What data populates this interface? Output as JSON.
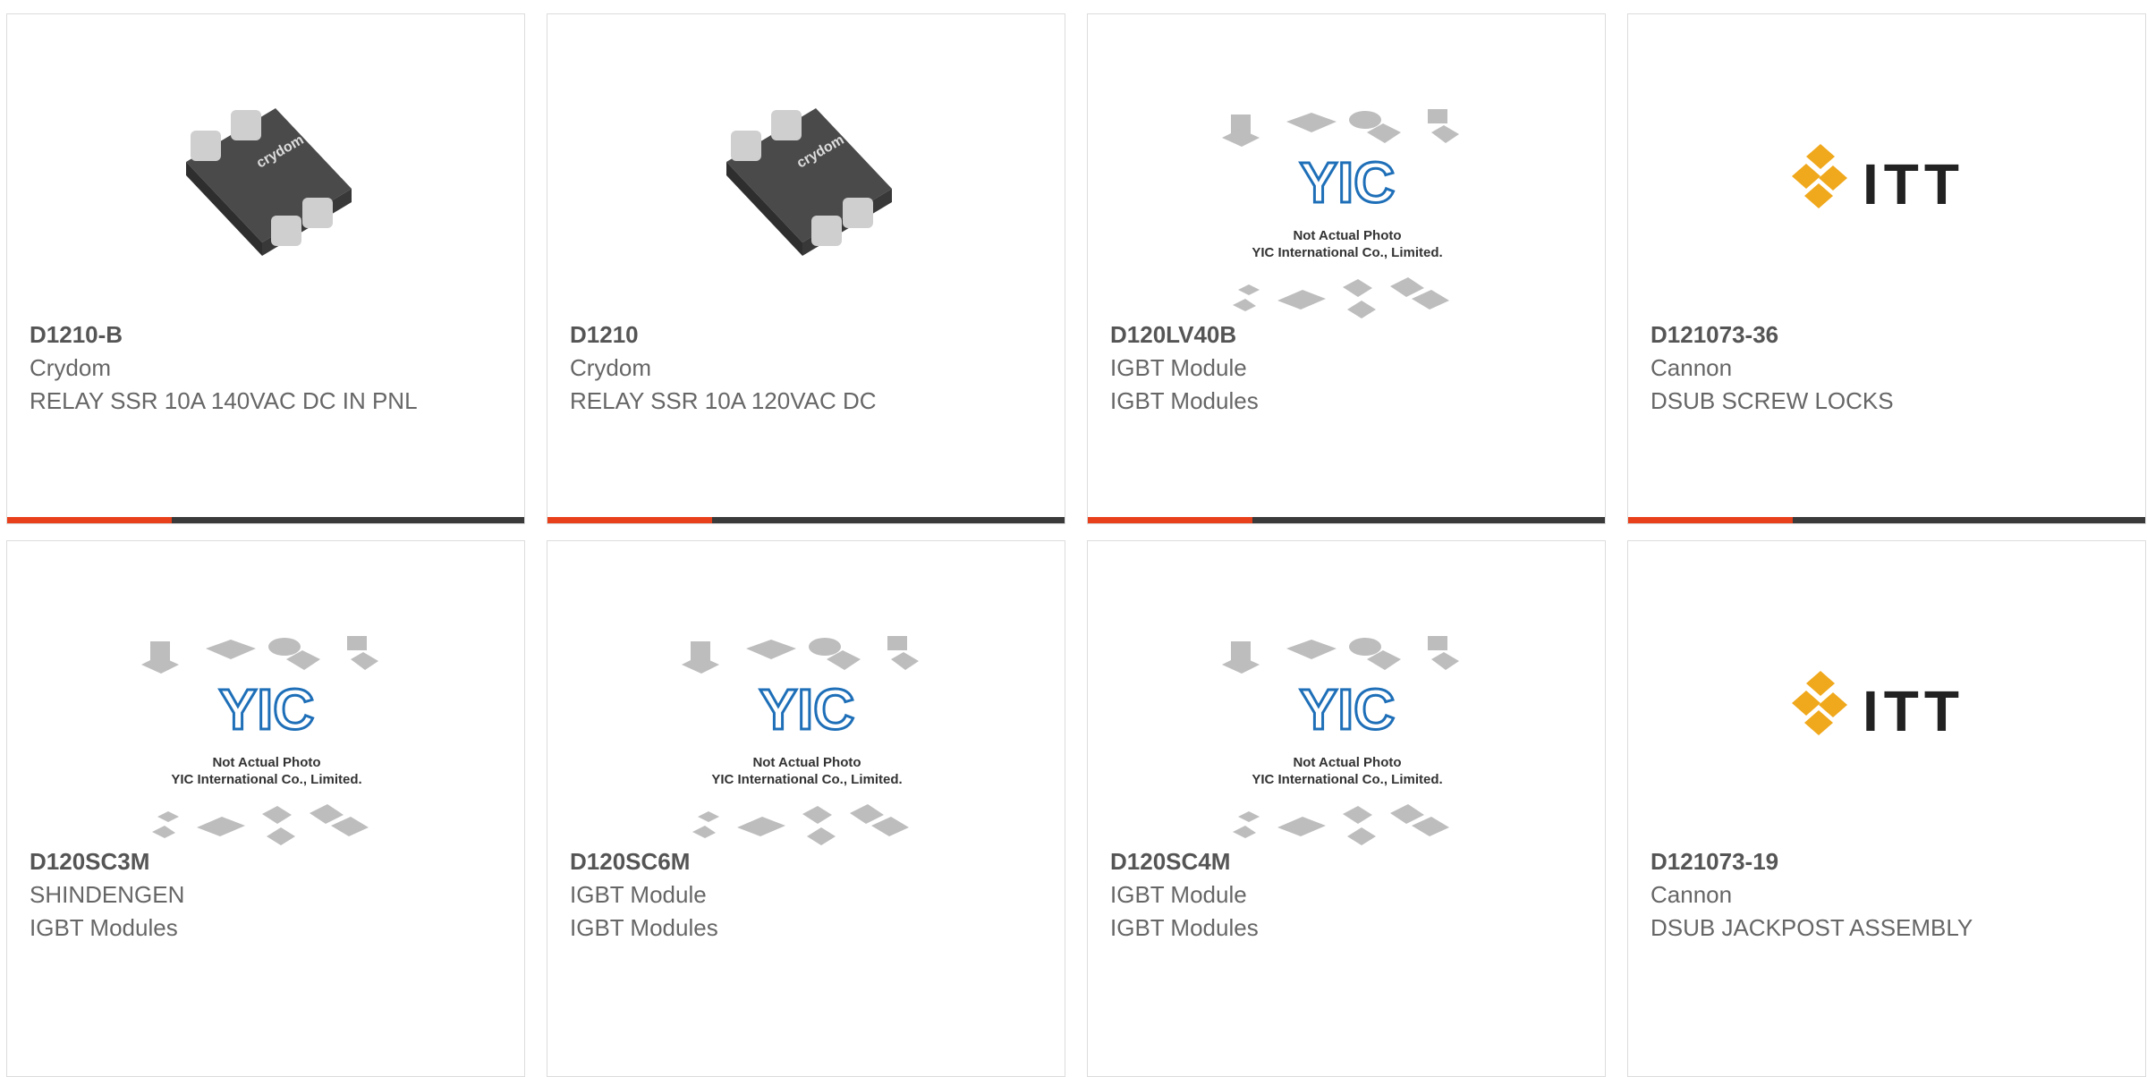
{
  "colors": {
    "accent": "#e8401a",
    "dark_bar": "#3a3a3a",
    "border": "#dcdcdc",
    "text": "#666666"
  },
  "products": [
    {
      "part": "D1210-B",
      "brand": "Crydom",
      "desc": "RELAY SSR 10A 140VAC DC IN PNL",
      "image": "crydom-relay"
    },
    {
      "part": "D1210",
      "brand": "Crydom",
      "desc": "RELAY SSR 10A 120VAC DC",
      "image": "crydom-relay"
    },
    {
      "part": "D120LV40B",
      "brand": "IGBT Module",
      "desc": "IGBT Modules",
      "image": "yic-placeholder"
    },
    {
      "part": "D121073-36",
      "brand": "Cannon",
      "desc": "DSUB SCREW LOCKS",
      "image": "itt-logo"
    },
    {
      "part": "D120SC3M",
      "brand": "SHINDENGEN",
      "desc": "IGBT Modules",
      "image": "yic-placeholder"
    },
    {
      "part": "D120SC6M",
      "brand": "IGBT Module",
      "desc": "IGBT Modules",
      "image": "yic-placeholder"
    },
    {
      "part": "D120SC4M",
      "brand": "IGBT Module",
      "desc": "IGBT Modules",
      "image": "yic-placeholder"
    },
    {
      "part": "D121073-19",
      "brand": "Cannon",
      "desc": "DSUB JACKPOST ASSEMBLY",
      "image": "itt-logo"
    }
  ],
  "placeholder": {
    "line1": "Not Actual Photo",
    "line2": "YIC International Co., Limited.",
    "logo": "YIC"
  },
  "itt_logo_text": "ITT",
  "crydom_brand_mark": "crydom"
}
